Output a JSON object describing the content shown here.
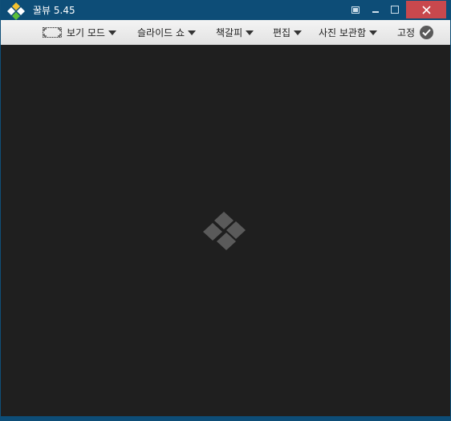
{
  "window": {
    "title": "꿀뷰 5.45",
    "colors": {
      "titlebar": "#0d4d77",
      "close": "#c8484d",
      "viewer_bg": "#1f1f1f"
    }
  },
  "titlebar": {
    "snap_icon": "window-snap-icon",
    "min_icon": "minimize-icon",
    "max_icon": "maximize-icon",
    "close_icon": "close-icon"
  },
  "menu": {
    "view_mode": "보기 모드",
    "slideshow": "슬라이드 쇼",
    "bookmark": "책갈피",
    "edit": "편집",
    "photo_album": "사진 보관함",
    "pin": "고정"
  }
}
